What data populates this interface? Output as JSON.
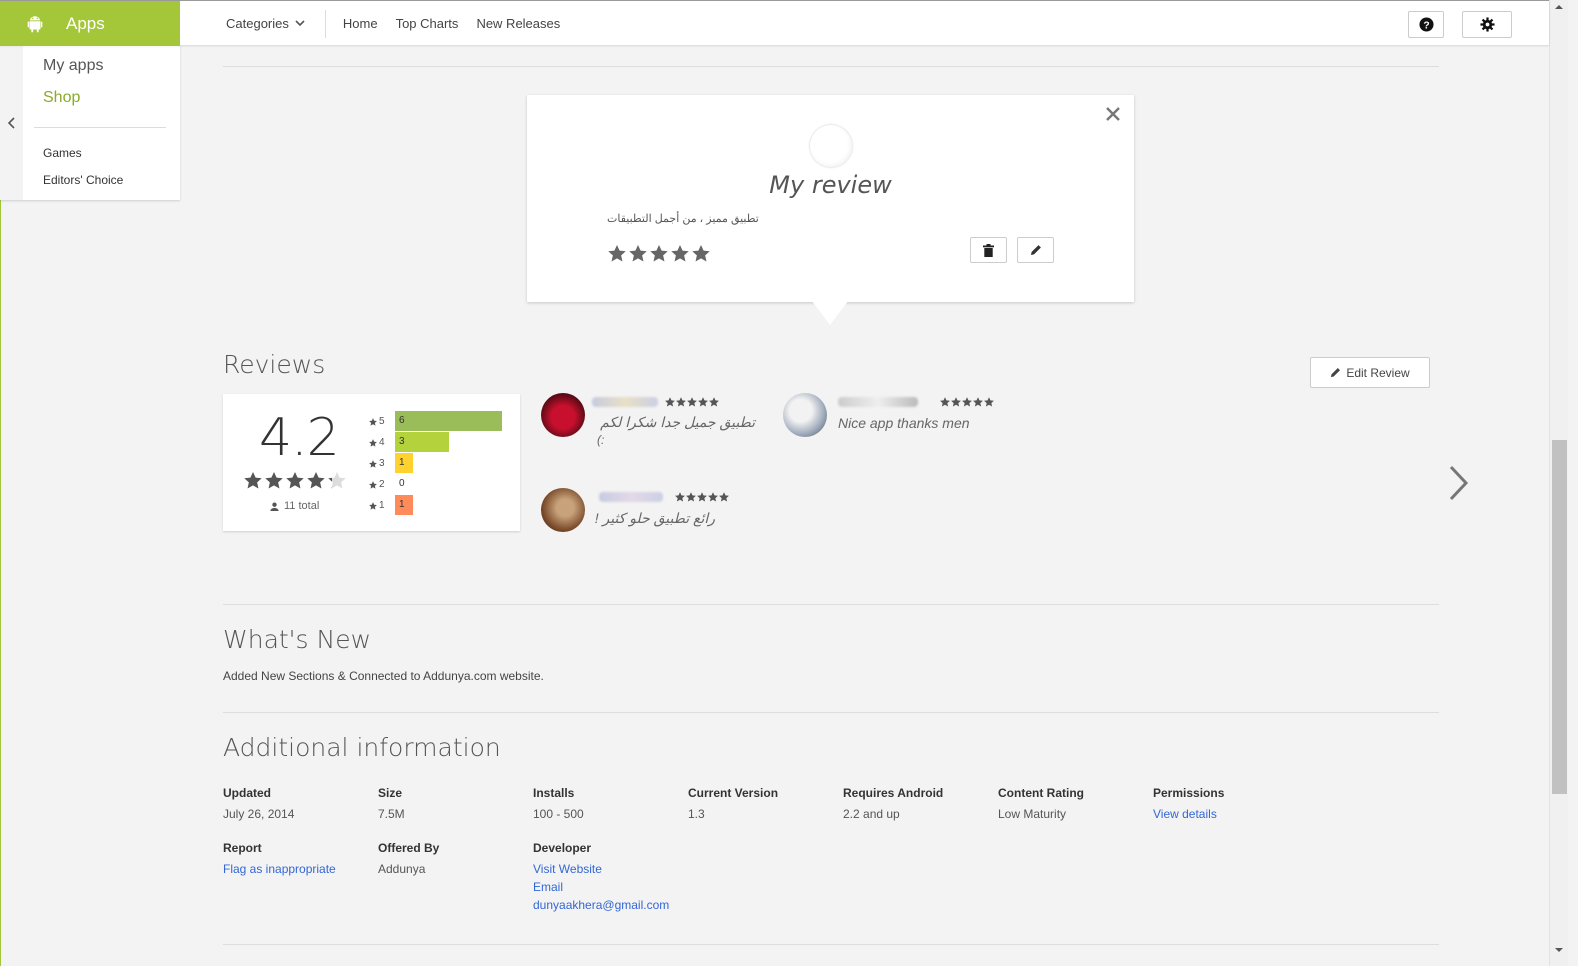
{
  "topbar": {
    "brand": "Apps",
    "categories_label": "Categories",
    "nav_links": [
      "Home",
      "Top Charts",
      "New Releases"
    ]
  },
  "sidebar": {
    "my_apps": "My apps",
    "shop": "Shop",
    "items": [
      "Games",
      "Editors' Choice"
    ]
  },
  "my_review": {
    "title": "My review",
    "text": "تطبيق مميز ، من أجمل التطبيقات",
    "rating": 5
  },
  "reviews": {
    "title": "Reviews",
    "edit_button": "Edit Review",
    "average": "4.2",
    "average_stars": 4.2,
    "total": "11 total",
    "histogram": [
      {
        "stars": "5",
        "count": "6",
        "value": 6,
        "color": "#9bbd59"
      },
      {
        "stars": "4",
        "count": "3",
        "value": 3,
        "color": "#b3d23b"
      },
      {
        "stars": "3",
        "count": "1",
        "value": 1,
        "color": "#ffd230"
      },
      {
        "stars": "2",
        "count": "0",
        "value": 0,
        "color": "#ffb234"
      },
      {
        "stars": "1",
        "count": "1",
        "value": 1,
        "color": "#ff8b5a"
      }
    ],
    "items": [
      {
        "text": "تطبيق جميل جدا شكرا لكم",
        "text2": "(:",
        "rating": 5
      },
      {
        "text": "Nice app thanks men",
        "rating": 5
      },
      {
        "text": "رائع تطبيق حلو كثير !",
        "rating": 5
      }
    ]
  },
  "whats_new": {
    "title": "What's New",
    "text": "Added New Sections & Connected to Addunya.com website."
  },
  "additional": {
    "title": "Additional information",
    "updated_label": "Updated",
    "updated": "July 26, 2014",
    "size_label": "Size",
    "size": "7.5M",
    "installs_label": "Installs",
    "installs": "100 - 500",
    "version_label": "Current Version",
    "version": "1.3",
    "android_label": "Requires Android",
    "android": "2.2 and up",
    "content_label": "Content Rating",
    "content": "Low Maturity",
    "permissions_label": "Permissions",
    "permissions_link": "View details",
    "report_label": "Report",
    "report_link": "Flag as inappropriate",
    "offered_label": "Offered By",
    "offered": "Addunya",
    "developer_label": "Developer",
    "developer_links": [
      "Visit Website",
      "Email",
      "dunyaakhera@gmail.com"
    ]
  }
}
